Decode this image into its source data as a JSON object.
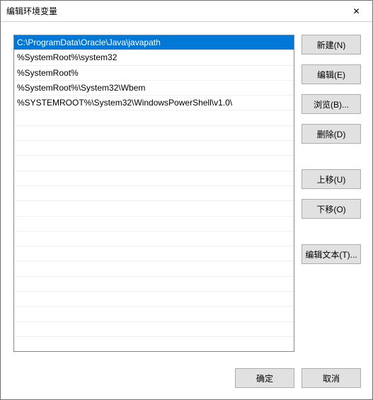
{
  "window": {
    "title": "编辑环境变量",
    "close_icon": "✕"
  },
  "list": {
    "entries": [
      "C:\\ProgramData\\Oracle\\Java\\javapath",
      "%SystemRoot%\\system32",
      "%SystemRoot%",
      "%SystemRoot%\\System32\\Wbem",
      "%SYSTEMROOT%\\System32\\WindowsPowerShell\\v1.0\\"
    ],
    "selected_index": 0,
    "visible_rows": 21
  },
  "buttons": {
    "new": "新建(N)",
    "edit": "编辑(E)",
    "browse": "浏览(B)...",
    "delete": "删除(D)",
    "move_up": "上移(U)",
    "move_down": "下移(O)",
    "edit_text": "编辑文本(T)...",
    "ok": "确定",
    "cancel": "取消"
  }
}
